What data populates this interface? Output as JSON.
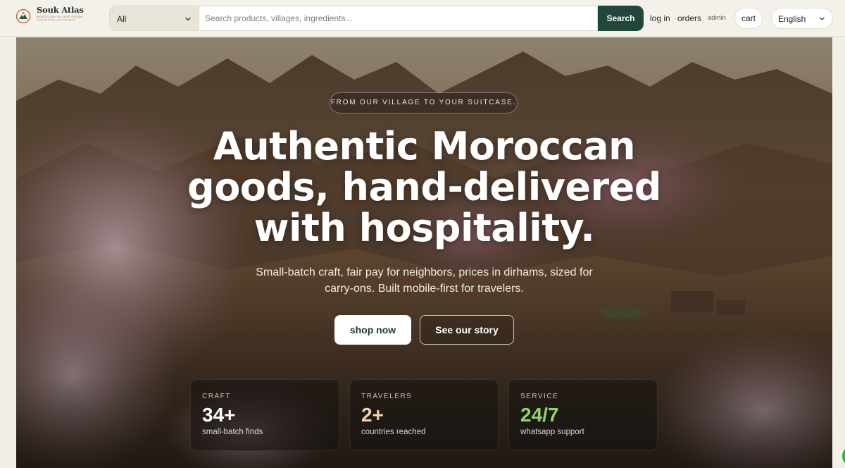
{
  "brand": {
    "name": "Souk Atlas",
    "tagline": "MOROCCAN VILLAGE GOODS",
    "subtagline": "crafted with heritage, guided with warmth"
  },
  "header": {
    "category_selected": "All",
    "search_placeholder": "Search products, villages, ingredients...",
    "search_label": "Search",
    "login_label": "log in",
    "orders_label": "orders",
    "admin_label": "admin",
    "cart_label": "cart",
    "language_selected": "English"
  },
  "hero": {
    "eyebrow": "FROM OUR VILLAGE TO YOUR SUITCASE.",
    "headline_line1": "Authentic Moroccan",
    "headline_line2": "goods, hand-delivered",
    "headline_line3": "with hospitality.",
    "subhead_line1": "Small-batch craft, fair pay for neighbors, prices in dirhams, sized for",
    "subhead_line2": "carry-ons. Built mobile-first for travelers.",
    "primary_cta": "shop now",
    "secondary_cta": "See our story"
  },
  "stats": [
    {
      "label": "CRAFT",
      "value": "34+",
      "caption": "small-batch finds",
      "color": "#ffffff"
    },
    {
      "label": "TRAVELERS",
      "value": "2+",
      "caption": "countries reached",
      "color": "#efd3a6"
    },
    {
      "label": "SERVICE",
      "value": "24/7",
      "caption": "whatsapp support",
      "color": "#8fd66a"
    }
  ],
  "colors": {
    "accent_green": "#21473c",
    "topbar_bg": "#f4f1ea",
    "chat_green": "#2bb44a"
  },
  "icons": {
    "logo": "mountain-sun-emblem",
    "category_dropdown": "chevron-down-icon",
    "language_dropdown": "chevron-down-icon",
    "chat": "whatsapp-chat-icon"
  }
}
